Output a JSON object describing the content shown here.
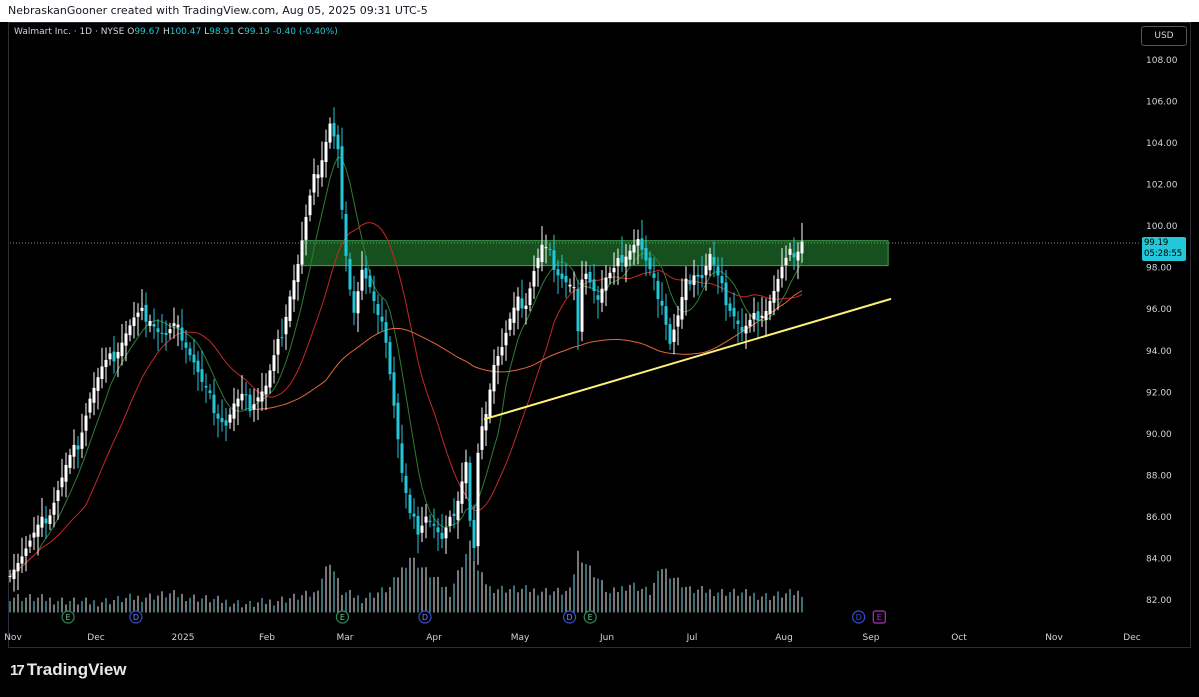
{
  "header": {
    "credit": "NebraskanGooner created with TradingView.com, Aug 05, 2025 09:31 UTC-5"
  },
  "legend": {
    "symbol": "Walmart Inc. · 1D · NYSE",
    "open_label": "O",
    "open": "99.67",
    "high_label": "H",
    "high": "100.47",
    "low_label": "L",
    "low": "98.91",
    "close_label": "C",
    "close": "99.19",
    "change": "-0.40 (-0.40%)"
  },
  "currency_button": "USD",
  "current_price": {
    "price": "99.19",
    "countdown": "05:28:55"
  },
  "footer": {
    "brand": "TradingView"
  },
  "colors": {
    "up": "#ffffff",
    "down": "#22c7d9",
    "ema_fast": "#2e7d32",
    "ema_mid": "#c62828",
    "ma_slow": "#e0683a",
    "trendline": "#fff176",
    "zone": "#1e6b2a",
    "axis_text": "#d1d4dc"
  },
  "event_icons": [
    "E",
    "D"
  ],
  "chart_data": {
    "type": "candlestick",
    "ylim": [
      81,
      109
    ],
    "yticks": [
      "82.00",
      "84.00",
      "86.00",
      "88.00",
      "90.00",
      "92.00",
      "94.00",
      "96.00",
      "98.00",
      "100.00",
      "102.00",
      "104.00",
      "106.00",
      "108.00"
    ],
    "xticks": [
      "Nov",
      "Dec",
      "2025",
      "Feb",
      "Mar",
      "Apr",
      "May",
      "Jun",
      "Jul",
      "Aug",
      "Sep",
      "Oct",
      "Nov",
      "Dec"
    ],
    "current_price": 99.19,
    "resistance_zone": [
      98.1,
      99.3
    ],
    "trendline": {
      "from": [
        "2025-04-09",
        90.7
      ],
      "to": [
        "2025-08-25",
        96.5
      ]
    },
    "price_path": [
      [
        0,
        83.5
      ],
      [
        3,
        84.2
      ],
      [
        7,
        85.4
      ],
      [
        10,
        86.3
      ],
      [
        14,
        88.4
      ],
      [
        17,
        89.6
      ],
      [
        20,
        91.8
      ],
      [
        23,
        93.1
      ],
      [
        26,
        93.8
      ],
      [
        29,
        94.9
      ],
      [
        31,
        95.5
      ],
      [
        33,
        95.8
      ],
      [
        35,
        95.7
      ],
      [
        37,
        95.0
      ],
      [
        39,
        94.7
      ],
      [
        41,
        95.1
      ],
      [
        43,
        94.8
      ],
      [
        46,
        93.5
      ],
      [
        48,
        92.4
      ],
      [
        50,
        91.7
      ],
      [
        52,
        91.0
      ],
      [
        54,
        90.5
      ],
      [
        56,
        91.4
      ],
      [
        58,
        91.7
      ],
      [
        60,
        91.4
      ],
      [
        62,
        91.9
      ],
      [
        64,
        92.3
      ],
      [
        66,
        93.6
      ],
      [
        68,
        95.0
      ],
      [
        70,
        96.8
      ],
      [
        72,
        98.2
      ],
      [
        74,
        100.3
      ],
      [
        76,
        102.2
      ],
      [
        78,
        103.4
      ],
      [
        79,
        104.2
      ],
      [
        80,
        105.0
      ],
      [
        81,
        104.3
      ],
      [
        82,
        103.6
      ],
      [
        83,
        100.6
      ],
      [
        84,
        98.3
      ],
      [
        85,
        97.3
      ],
      [
        86,
        96.1
      ],
      [
        88,
        98.0
      ],
      [
        90,
        97.0
      ],
      [
        92,
        95.5
      ],
      [
        94,
        94.7
      ],
      [
        96,
        91.5
      ],
      [
        98,
        88.1
      ],
      [
        100,
        86.0
      ],
      [
        102,
        85.5
      ],
      [
        104,
        86.2
      ],
      [
        106,
        85.6
      ],
      [
        108,
        84.8
      ],
      [
        110,
        85.7
      ],
      [
        112,
        87.0
      ],
      [
        114,
        88.7
      ],
      [
        115,
        85.8
      ],
      [
        116,
        84.4
      ],
      [
        117,
        88.9
      ],
      [
        119,
        91.3
      ],
      [
        121,
        93.5
      ],
      [
        123,
        94.2
      ],
      [
        125,
        95.4
      ],
      [
        127,
        96.3
      ],
      [
        129,
        96.4
      ],
      [
        131,
        97.9
      ],
      [
        133,
        99.0
      ],
      [
        135,
        98.6
      ],
      [
        137,
        97.9
      ],
      [
        139,
        97.4
      ],
      [
        141,
        97.0
      ],
      [
        142,
        94.8
      ],
      [
        143,
        97.2
      ],
      [
        145,
        97.6
      ],
      [
        147,
        96.6
      ],
      [
        149,
        97.5
      ],
      [
        151,
        97.8
      ],
      [
        153,
        98.6
      ],
      [
        155,
        99.0
      ],
      [
        157,
        99.4
      ],
      [
        159,
        98.2
      ],
      [
        161,
        97.2
      ],
      [
        163,
        96.4
      ],
      [
        165,
        94.4
      ],
      [
        167,
        95.6
      ],
      [
        169,
        97.2
      ],
      [
        171,
        97.9
      ],
      [
        173,
        97.6
      ],
      [
        175,
        98.6
      ],
      [
        177,
        97.4
      ],
      [
        179,
        96.5
      ],
      [
        181,
        95.8
      ],
      [
        183,
        94.9
      ],
      [
        185,
        95.3
      ],
      [
        187,
        95.8
      ],
      [
        189,
        96.1
      ],
      [
        191,
        96.9
      ],
      [
        193,
        97.9
      ],
      [
        195,
        98.6
      ],
      [
        197,
        99.0
      ],
      [
        198,
        99.4
      ]
    ],
    "volume_path": [
      [
        0,
        82.2
      ],
      [
        20,
        81.9
      ],
      [
        40,
        82.3
      ],
      [
        60,
        81.8
      ],
      [
        76,
        82.3
      ],
      [
        80,
        83.9
      ],
      [
        83,
        82.4
      ],
      [
        88,
        82.1
      ],
      [
        95,
        82.6
      ],
      [
        100,
        84.1
      ],
      [
        110,
        82.4
      ],
      [
        115,
        84.7
      ],
      [
        117,
        83.4
      ],
      [
        120,
        82.6
      ],
      [
        140,
        82.4
      ],
      [
        142,
        84.3
      ],
      [
        150,
        82.3
      ],
      [
        155,
        82.8
      ],
      [
        160,
        82.4
      ],
      [
        163,
        83.6
      ],
      [
        170,
        82.5
      ],
      [
        180,
        82.4
      ],
      [
        190,
        82.2
      ],
      [
        198,
        82.4
      ]
    ],
    "event_markers": [
      {
        "icon": "E",
        "date": "2024-11-19"
      },
      {
        "icon": "D",
        "date": "2024-12-12"
      },
      {
        "icon": "E",
        "date": "2025-02-20"
      },
      {
        "icon": "D",
        "date": "2025-03-20"
      },
      {
        "icon": "D",
        "date": "2025-05-08"
      },
      {
        "icon": "E",
        "date": "2025-05-15"
      },
      {
        "icon": "D",
        "date": "2025-08-14"
      },
      {
        "icon": "E",
        "date": "2025-08-21"
      }
    ]
  }
}
